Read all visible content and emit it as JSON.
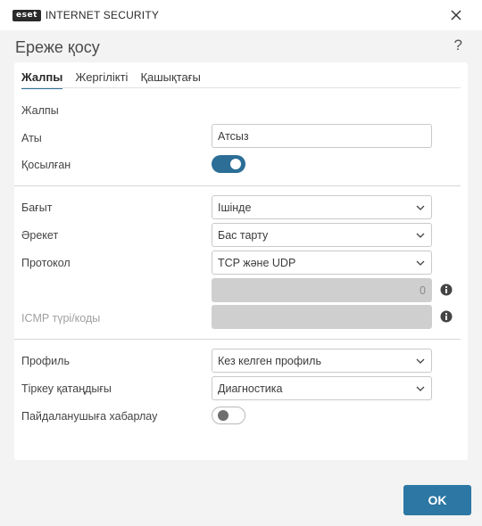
{
  "titlebar": {
    "logo_text": "eset",
    "product_name": "INTERNET SECURITY",
    "close_icon": "close-icon"
  },
  "dialog": {
    "title": "Ереже қосу",
    "help": "?"
  },
  "tabs": [
    {
      "label": "Жалпы",
      "active": true
    },
    {
      "label": "Жергілікті",
      "active": false
    },
    {
      "label": "Қашықтағы",
      "active": false
    }
  ],
  "general": {
    "section_label": "Жалпы",
    "name_label": "Аты",
    "name_value": "Атсыз",
    "enabled_label": "Қосылған",
    "enabled": true
  },
  "rule": {
    "direction_label": "Бағыт",
    "direction_value": "Ішінде",
    "action_label": "Әрекет",
    "action_value": "Бас тарту",
    "protocol_label": "Протокол",
    "protocol_value": "TCP және UDP",
    "protocol_number_value": "0",
    "icmp_label": "ICMP түрі/коды",
    "icmp_value": ""
  },
  "profile": {
    "profile_label": "Профиль",
    "profile_value": "Кез келген профиль",
    "logging_label": "Тіркеу қатаңдығы",
    "logging_value": "Диагностика",
    "notify_label": "Пайдаланушыға хабарлау",
    "notify": false
  },
  "footer": {
    "ok_label": "OK"
  },
  "colors": {
    "accent": "#2c6e96",
    "ok_button": "#2c77a3",
    "disabled_field": "#cfcfcf"
  }
}
